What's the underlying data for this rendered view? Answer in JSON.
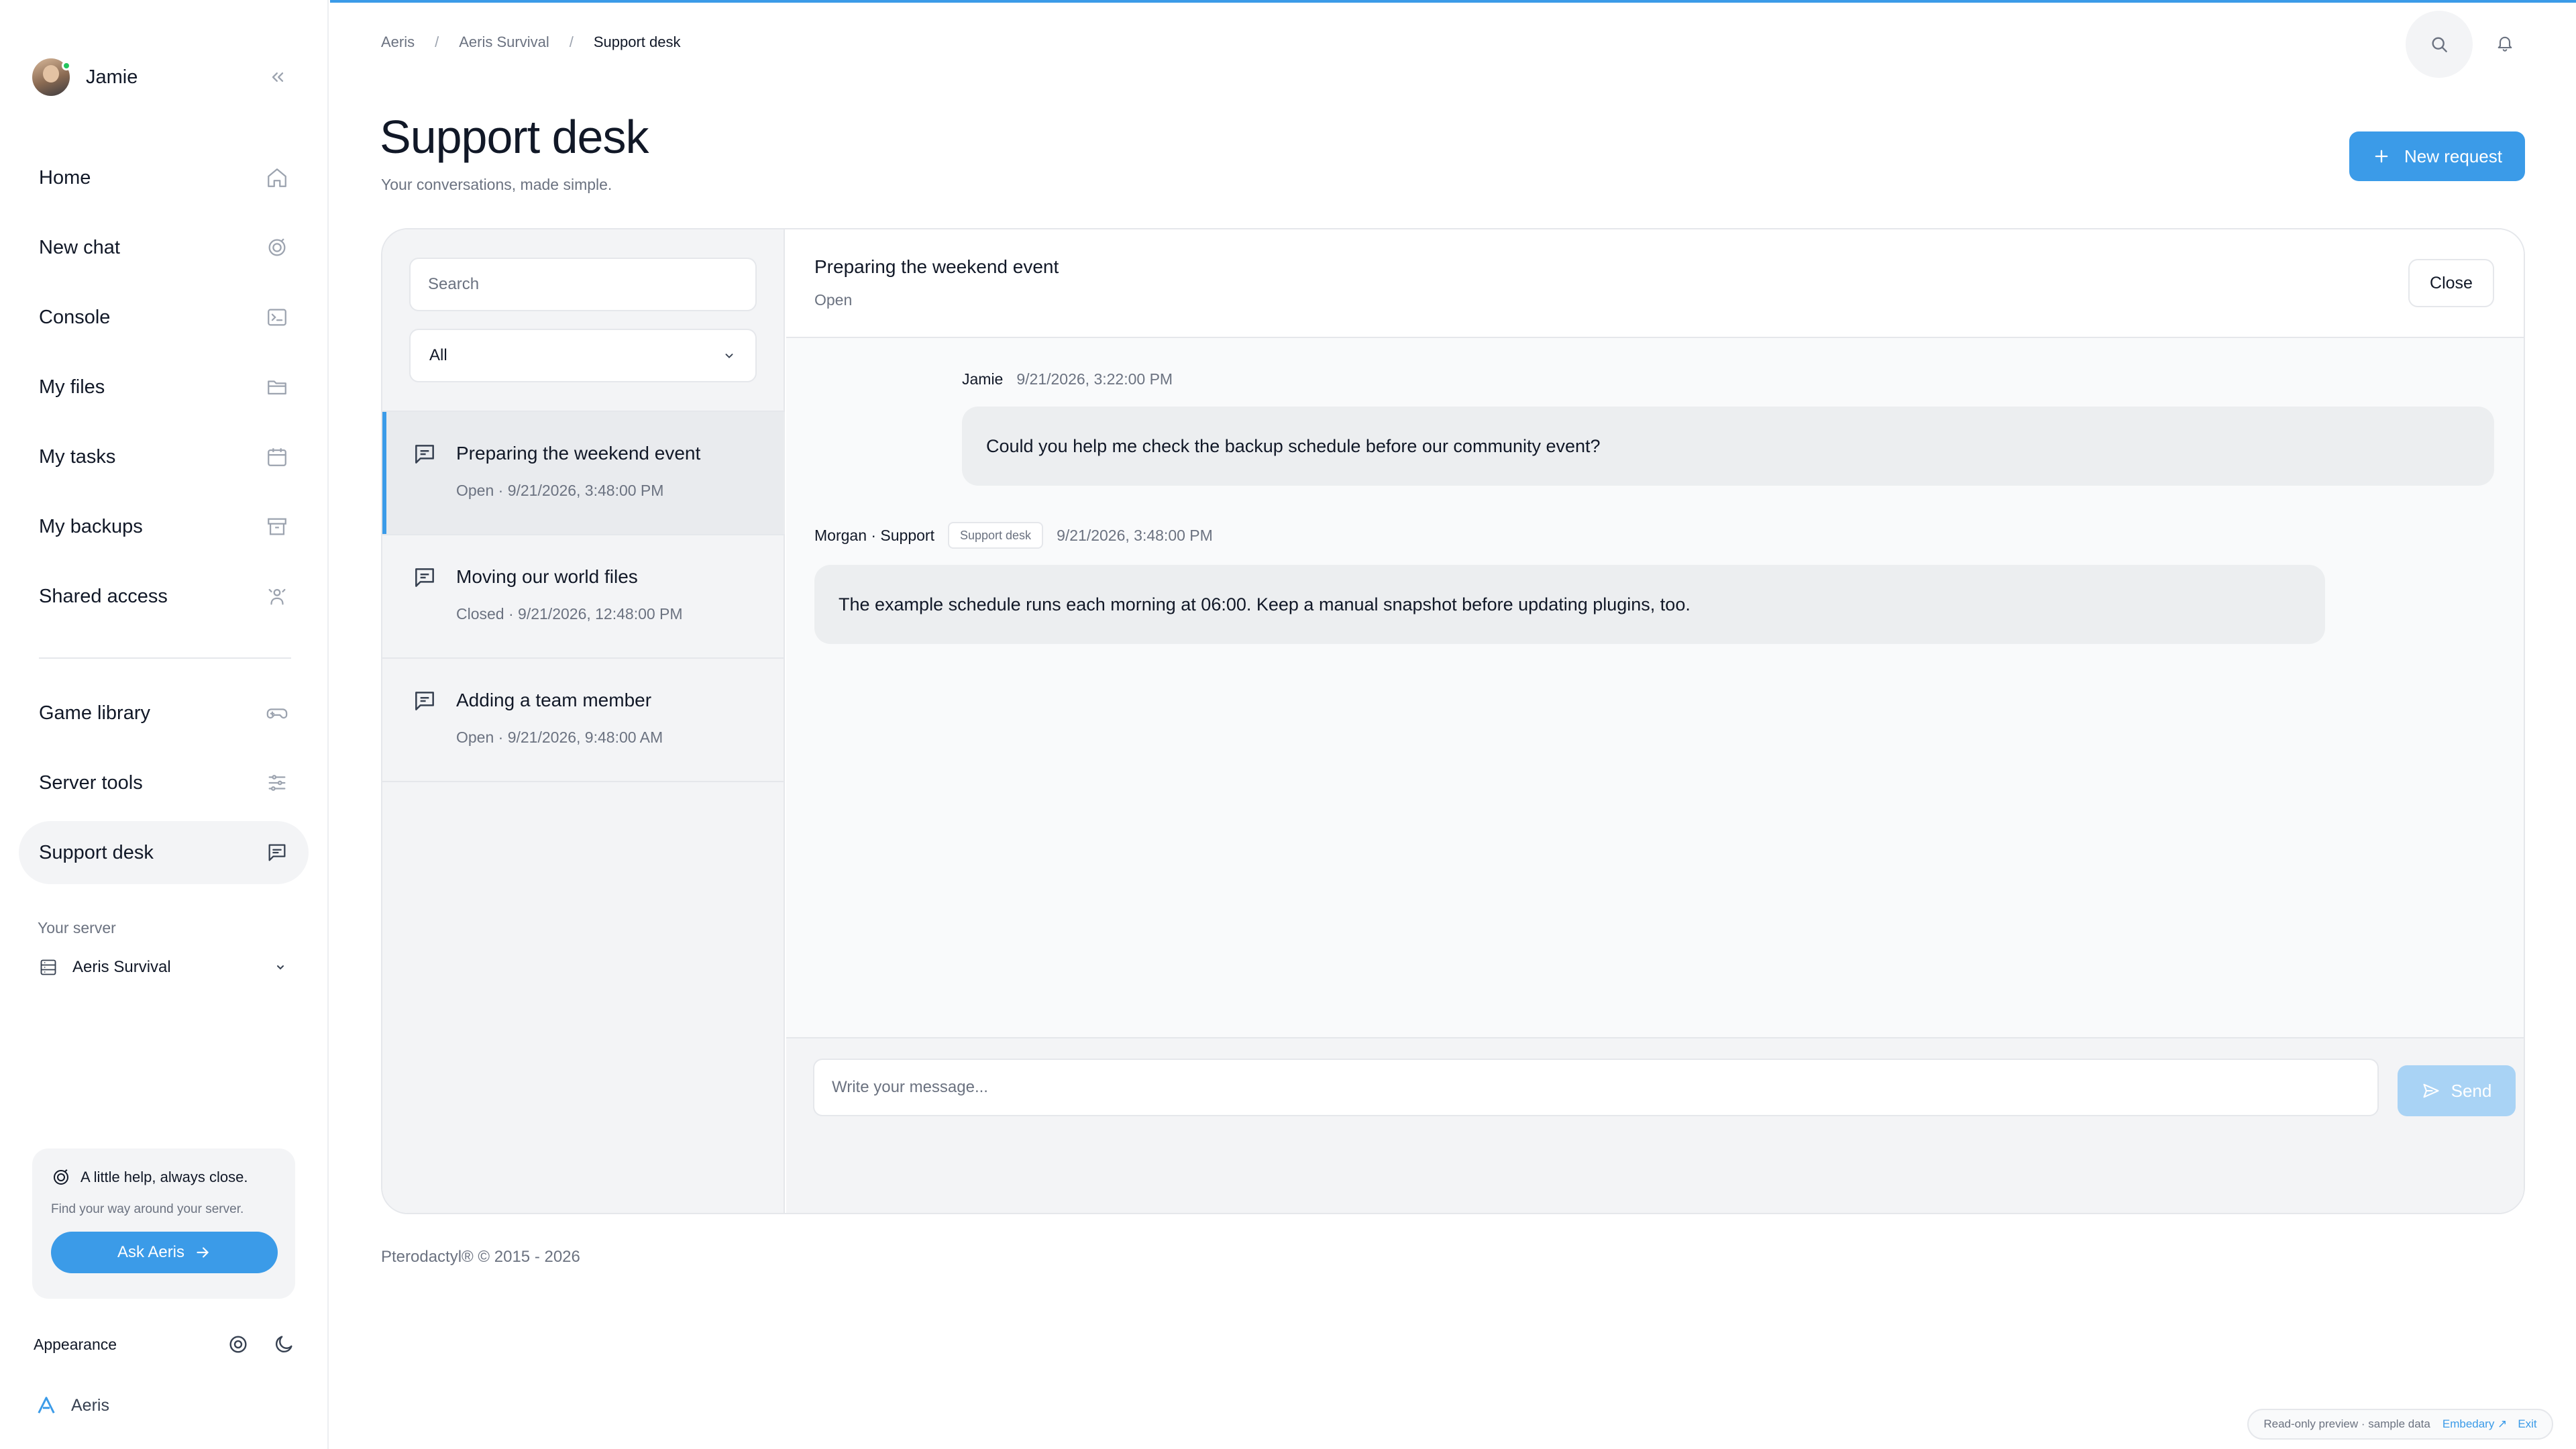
{
  "user": {
    "name": "Jamie"
  },
  "sidebar": {
    "items": [
      {
        "label": "Home",
        "icon": "home-icon"
      },
      {
        "label": "New chat",
        "icon": "sparkle-icon"
      },
      {
        "label": "Console",
        "icon": "terminal-icon"
      },
      {
        "label": "My files",
        "icon": "folder-icon"
      },
      {
        "label": "My tasks",
        "icon": "calendar-icon"
      },
      {
        "label": "My backups",
        "icon": "archive-icon"
      },
      {
        "label": "Shared access",
        "icon": "users-icon"
      },
      {
        "label": "Game library",
        "icon": "gamepad-icon"
      },
      {
        "label": "Server tools",
        "icon": "sliders-icon"
      },
      {
        "label": "Support desk",
        "icon": "message-icon"
      }
    ],
    "active": "Support desk",
    "server_label": "Your server",
    "server_name": "Aeris Survival",
    "help_title": "A little help, always close.",
    "help_sub": "Find your way around your server.",
    "ask_label": "Ask Aeris",
    "appearance_label": "Appearance",
    "brand": "Aeris"
  },
  "breadcrumb": [
    "Aeris",
    "Aeris Survival",
    "Support desk"
  ],
  "page": {
    "title": "Support desk",
    "subtitle": "Your conversations, made simple.",
    "new_request": "New request"
  },
  "list": {
    "search_placeholder": "Search",
    "filter_value": "All",
    "conversations": [
      {
        "title": "Preparing the weekend event",
        "meta": "Open · 9/21/2026, 3:48:00 PM",
        "active": true
      },
      {
        "title": "Moving our world files",
        "meta": "Closed · 9/21/2026, 12:48:00 PM",
        "active": false
      },
      {
        "title": "Adding a team member",
        "meta": "Open · 9/21/2026, 9:48:00 AM",
        "active": false
      }
    ]
  },
  "thread": {
    "title": "Preparing the weekend event",
    "status": "Open",
    "close_label": "Close",
    "messages": [
      {
        "author": "Jamie",
        "time": "9/21/2026, 3:22:00 PM",
        "text": "Could you help me check the backup schedule before our community event?"
      },
      {
        "author": "Morgan · Support",
        "badge": "Support desk",
        "time": "9/21/2026, 3:48:00 PM",
        "text": "The example schedule runs each morning at 06:00. Keep a manual snapshot before updating plugins, too."
      }
    ],
    "input_placeholder": "Write your message...",
    "send_label": "Send"
  },
  "footer": "Pterodactyl® © 2015 - 2026",
  "preview": {
    "text": "Read-only preview · sample data",
    "link": "Embedary ↗",
    "exit": "Exit"
  },
  "colors": {
    "accent": "#3b9be8",
    "online": "#22c55e"
  }
}
